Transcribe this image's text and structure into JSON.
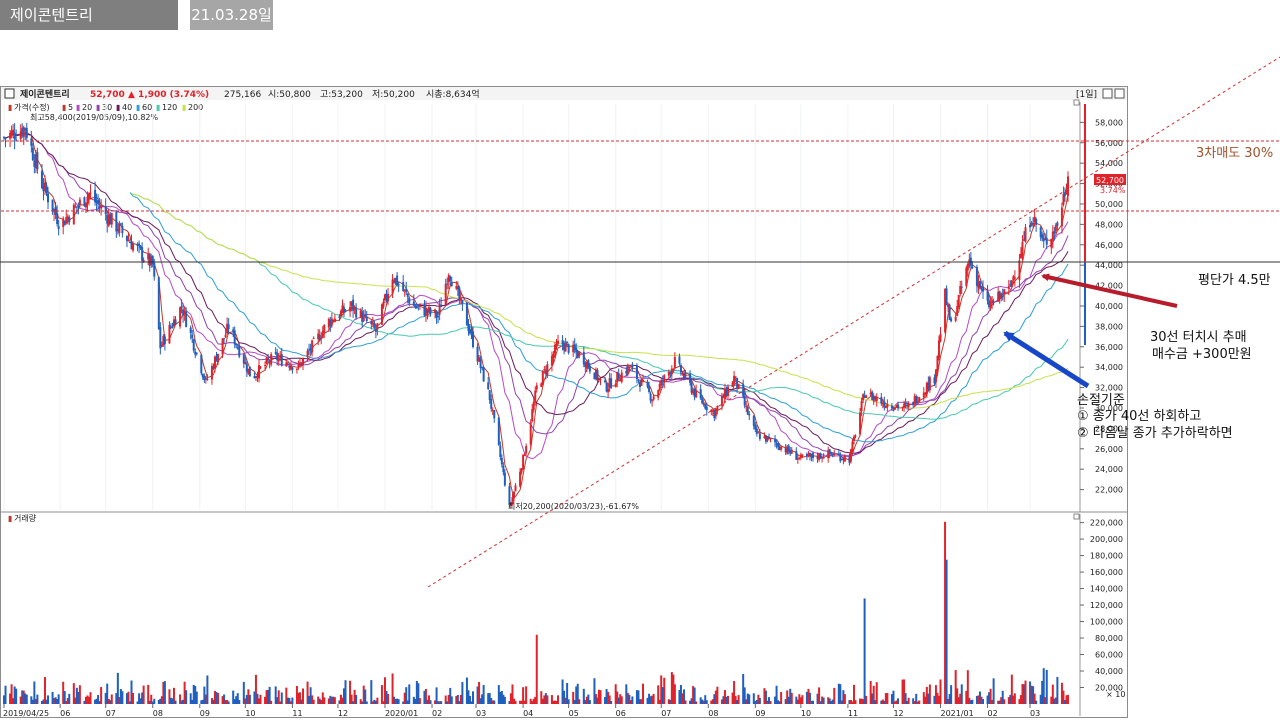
{
  "header": {
    "name": "제이콘텐트리",
    "date": "21.03.28일"
  },
  "quote": {
    "name": "제이콘텐트리",
    "price": "52,700",
    "change": "▲ 1,900 (3.74%)",
    "volume": "275,166",
    "open": "시:50,800",
    "high": "고:53,200",
    "low": "저:50,200",
    "mcap": "시총:8,634억",
    "period": "[1일]"
  },
  "legend": {
    "title": "가격(수정)",
    "ma": [
      {
        "label": "5",
        "color": "#c0392b"
      },
      {
        "label": "20",
        "color": "#b44bc9"
      },
      {
        "label": "30",
        "color": "#8e44ad"
      },
      {
        "label": "40",
        "color": "#6a1b5a"
      },
      {
        "label": "60",
        "color": "#2e9fd8"
      },
      {
        "label": "120",
        "color": "#48c9b0"
      },
      {
        "label": "200",
        "color": "#c8e04a"
      }
    ],
    "high_note": "최고58,400(2019/05/09),10.82%",
    "low_note": "최저20,200(2020/03/23),-61.67%",
    "volume_title": "거래량"
  },
  "badges": {
    "price": "52,700",
    "pct": "3.74%",
    "vol_unit": "× 10"
  },
  "annotations": {
    "sell3": "3차매도 30%",
    "avg": "평단가 4.5만",
    "add1": "30선 터치시 추매",
    "add2": "매수금 +300만원",
    "stop_title": "손절기준",
    "stop1": "① 종가 40선 하회하고",
    "stop2": "② 다음날 종가 추가하락하면"
  },
  "colors": {
    "up": "#e0232b",
    "down": "#1f5fbf",
    "guide": "#d03030",
    "avg_line": "#333333",
    "arrow_red": "#b71c2c",
    "arrow_blue": "#1747c8",
    "sell_text": "#a0522d"
  },
  "chart_data": [
    {
      "type": "candlestick",
      "title": "",
      "x_ticks": [
        "2019/04/25",
        "06",
        "07",
        "08",
        "09",
        "10",
        "11",
        "12",
        "2020/01",
        "02",
        "03",
        "04",
        "05",
        "06",
        "07",
        "08",
        "09",
        "10",
        "11",
        "12",
        "2021/01",
        "02",
        "03"
      ],
      "y_ticks": [
        22000,
        24000,
        26000,
        28000,
        30000,
        32000,
        34000,
        36000,
        38000,
        40000,
        42000,
        44000,
        46000,
        48000,
        50000,
        52000,
        54000,
        56000,
        58000
      ],
      "ylim": [
        20000,
        59800
      ],
      "close_series": [
        {
          "date": "2019/04/25",
          "value": 56500
        },
        {
          "date": "2019/05/09",
          "value": 57500
        },
        {
          "date": "2019/05/20",
          "value": 52000
        },
        {
          "date": "2019/06/01",
          "value": 48000
        },
        {
          "date": "2019/06/20",
          "value": 51000
        },
        {
          "date": "2019/07/01",
          "value": 49000
        },
        {
          "date": "2019/07/25",
          "value": 45000
        },
        {
          "date": "2019/08/01",
          "value": 44000
        },
        {
          "date": "2019/08/06",
          "value": 36000
        },
        {
          "date": "2019/08/20",
          "value": 40000
        },
        {
          "date": "2019/09/05",
          "value": 32500
        },
        {
          "date": "2019/09/20",
          "value": 38000
        },
        {
          "date": "2019/10/05",
          "value": 33000
        },
        {
          "date": "2019/10/20",
          "value": 35000
        },
        {
          "date": "2019/11/05",
          "value": 34000
        },
        {
          "date": "2019/11/25",
          "value": 38500
        },
        {
          "date": "2019/12/10",
          "value": 40000
        },
        {
          "date": "2019/12/26",
          "value": 37500
        },
        {
          "date": "2020/01/06",
          "value": 43000
        },
        {
          "date": "2020/01/20",
          "value": 40000
        },
        {
          "date": "2020/02/05",
          "value": 39000
        },
        {
          "date": "2020/02/12",
          "value": 43500
        },
        {
          "date": "2020/02/25",
          "value": 38000
        },
        {
          "date": "2020/03/10",
          "value": 31000
        },
        {
          "date": "2020/03/23",
          "value": 20200
        },
        {
          "date": "2020/04/01",
          "value": 25000
        },
        {
          "date": "2020/04/10",
          "value": 32000
        },
        {
          "date": "2020/04/25",
          "value": 36500
        },
        {
          "date": "2020/05/10",
          "value": 35000
        },
        {
          "date": "2020/05/25",
          "value": 32000
        },
        {
          "date": "2020/06/10",
          "value": 34000
        },
        {
          "date": "2020/06/25",
          "value": 31000
        },
        {
          "date": "2020/07/10",
          "value": 34500
        },
        {
          "date": "2020/07/25",
          "value": 31000
        },
        {
          "date": "2020/08/05",
          "value": 29500
        },
        {
          "date": "2020/08/18",
          "value": 33000
        },
        {
          "date": "2020/09/01",
          "value": 27500
        },
        {
          "date": "2020/09/15",
          "value": 26500
        },
        {
          "date": "2020/10/01",
          "value": 25000
        },
        {
          "date": "2020/10/20",
          "value": 25500
        },
        {
          "date": "2020/11/02",
          "value": 25000
        },
        {
          "date": "2020/11/12",
          "value": 31500
        },
        {
          "date": "2020/11/25",
          "value": 30500
        },
        {
          "date": "2020/12/10",
          "value": 30000
        },
        {
          "date": "2020/12/28",
          "value": 33000
        },
        {
          "date": "2021/01/04",
          "value": 41000
        },
        {
          "date": "2021/01/08",
          "value": 38000
        },
        {
          "date": "2021/01/20",
          "value": 44500
        },
        {
          "date": "2021/02/01",
          "value": 40000
        },
        {
          "date": "2021/02/15",
          "value": 41500
        },
        {
          "date": "2021/03/02",
          "value": 49000
        },
        {
          "date": "2021/03/10",
          "value": 46000
        },
        {
          "date": "2021/03/19",
          "value": 48000
        },
        {
          "date": "2021/03/26",
          "value": 52700
        }
      ],
      "moving_averages": [
        "5",
        "20",
        "30",
        "40",
        "60",
        "120",
        "200"
      ],
      "reference_lines": [
        {
          "value": 57000
        },
        {
          "value": 49500
        },
        {
          "value": 44200
        }
      ]
    },
    {
      "type": "bar",
      "title": "거래량",
      "y_ticks": [
        20000,
        40000,
        60000,
        80000,
        100000,
        120000,
        140000,
        160000,
        180000,
        200000,
        220000
      ],
      "ylim": [
        0,
        228000
      ],
      "unit": "× 10",
      "peaks": [
        {
          "date": "2020/04/10",
          "value": 84000
        },
        {
          "date": "2020/11/12",
          "value": 128000
        },
        {
          "date": "2021/01/04",
          "value": 221000
        },
        {
          "date": "2021/01/05",
          "value": 175000
        }
      ],
      "typical_range": [
        3000,
        30000
      ]
    }
  ]
}
